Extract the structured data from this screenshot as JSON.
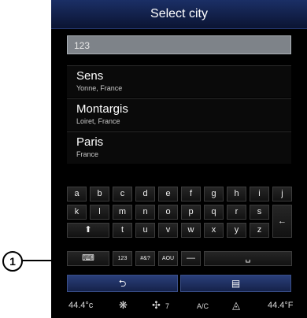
{
  "title": "Select city",
  "search": {
    "value": "123"
  },
  "results": [
    {
      "name": "Sens",
      "region": "Yonne, France"
    },
    {
      "name": "Montargis",
      "region": "Loiret, France"
    },
    {
      "name": "Paris",
      "region": "France"
    }
  ],
  "keyboard": {
    "row1": [
      "a",
      "b",
      "c",
      "d",
      "e",
      "f",
      "g",
      "h",
      "i",
      "j"
    ],
    "row2": [
      "k",
      "l",
      "m",
      "n",
      "o",
      "p",
      "q",
      "r",
      "s"
    ],
    "row3": [
      "t",
      "u",
      "v",
      "w",
      "x",
      "y",
      "z"
    ],
    "shift": "⬆",
    "backspace": "←",
    "mode_123": "123",
    "mode_symbols": "#&?",
    "mode_accents": "AOU",
    "dash": "—",
    "space": "␣",
    "hide": "⌨"
  },
  "bottom": {
    "back": "⮌",
    "list": "▤"
  },
  "status": {
    "temp_left": "44.4°c",
    "fan": "7",
    "ac": "A/C",
    "temp_right": "44.4°F"
  },
  "callout": {
    "label": "1"
  },
  "colors": {
    "accent": "#1b2f66",
    "screen_bg": "#000000"
  }
}
